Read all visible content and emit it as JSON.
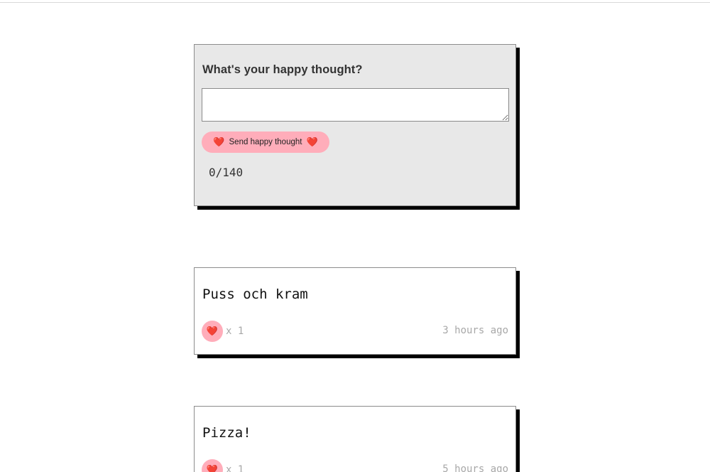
{
  "composer": {
    "title": "What's your happy thought?",
    "textarea_value": "",
    "textarea_placeholder": "",
    "send_label": "Send happy thought",
    "char_count": "0/140"
  },
  "icons": {
    "heart": "❤️",
    "heart_name": "heart-icon"
  },
  "thoughts": [
    {
      "message": "Puss och kram",
      "likes": "x 1",
      "time": "3 hours ago"
    },
    {
      "message": "Pizza!",
      "likes": "x 1",
      "time": "5 hours ago"
    }
  ],
  "colors": {
    "accent_pink": "#ffadba",
    "heart_red": "#e0303b",
    "composer_bg": "#e8e8e8",
    "shadow": "#000000",
    "muted_text": "#a8a8a8"
  }
}
